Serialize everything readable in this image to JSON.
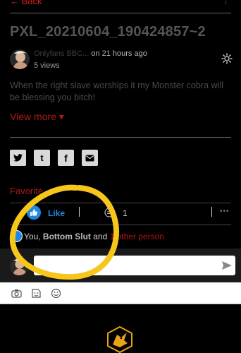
{
  "header": {
    "back_label": "← Back",
    "menu_icon": "more-vertical-icon"
  },
  "post": {
    "title": "PXL_20210604_190424857~2",
    "author": "Onlyfans BBC...",
    "time": "on 21 hours ago",
    "views": "5 views",
    "description": "When the right slave worships it my Monster cobra will be blessing you bitch!",
    "view_more": "View more ▾"
  },
  "share": {
    "icons": [
      "twitter-icon",
      "tumblr-icon",
      "facebook-icon",
      "email-icon"
    ]
  },
  "favorite_label": "Favorite",
  "reactions": {
    "like_label": "Like",
    "comment_count": "1",
    "more_label": "•••",
    "reactors_prefix": "You, ",
    "reactors_name": "Bottom Slut",
    "reactors_and": " and ",
    "reactors_other": "1 other person"
  },
  "composer": {
    "placeholder": "",
    "tools": [
      "camera-icon",
      "sticker-icon",
      "emoji-icon"
    ]
  },
  "colors": {
    "accent_red": "#b01818",
    "like_blue": "#1e88e5",
    "annotation_yellow": "#f7c61a"
  }
}
